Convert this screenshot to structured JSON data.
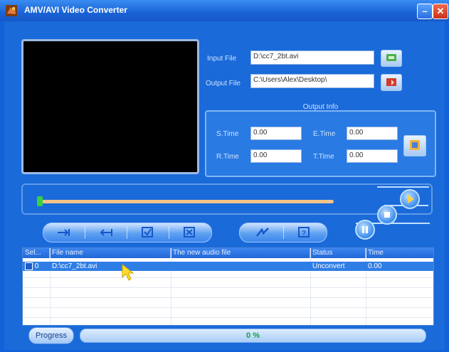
{
  "window": {
    "title": "AMV/AVI Video Converter"
  },
  "io": {
    "input_label": "Input File",
    "input_value": "D:\\cc7_2bt.avi",
    "output_label": "Output File",
    "output_value": "C:\\Users\\Alex\\Desktop\\"
  },
  "output_info": {
    "header": "Output Info",
    "stime_label": "S.Time",
    "stime_value": "0.00",
    "etime_label": "E.Time",
    "etime_value": "0.00",
    "rtime_label": "R.Time",
    "rtime_value": "0.00",
    "ttime_label": "T.Time",
    "ttime_value": "0.00"
  },
  "controls": {
    "seek_position": 0.0
  },
  "table": {
    "headers": [
      "Sel...",
      "File name",
      "The new audio file",
      "Status",
      "Time"
    ],
    "rows": [
      {
        "sel": "0",
        "file": "D:\\cc7_2bt.avi",
        "audio": "",
        "status": "Unconvert",
        "time": "0.00"
      }
    ]
  },
  "progress": {
    "button_label": "Progress",
    "text": "0 %"
  }
}
